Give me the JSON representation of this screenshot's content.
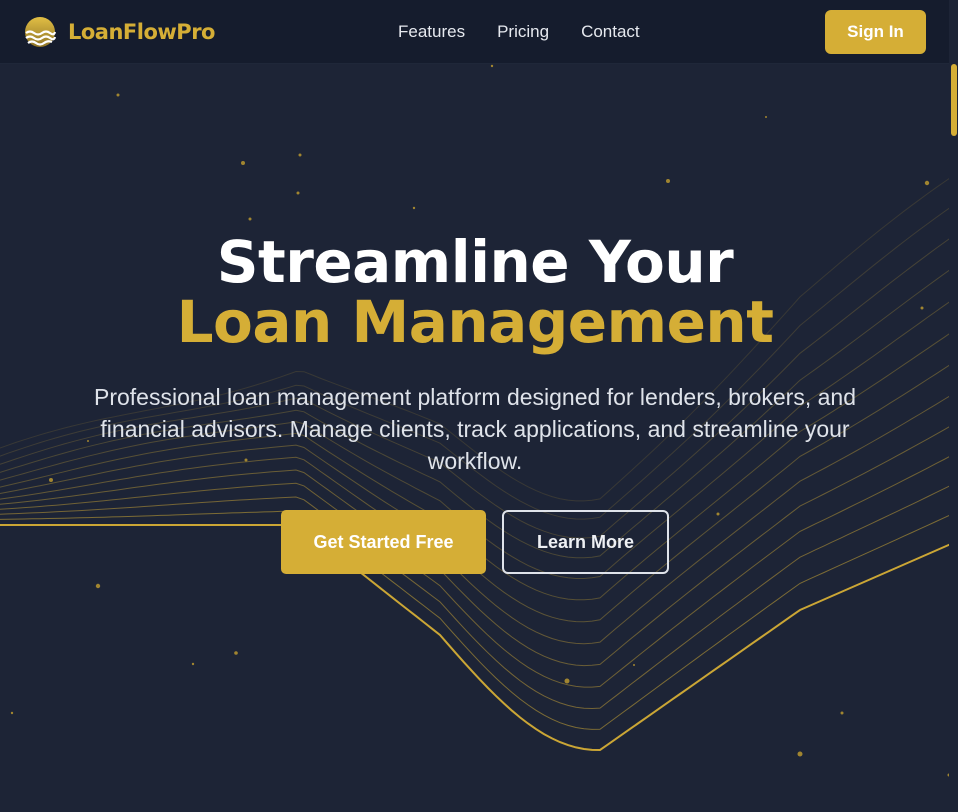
{
  "navbar": {
    "brand_name": "LoanFlowPro",
    "logo_icon": "sun-over-waves-icon",
    "links": [
      "Features",
      "Pricing",
      "Contact"
    ],
    "signin_label": "Sign In"
  },
  "hero": {
    "title_line1": "Streamline Your",
    "title_line2": "Loan Management",
    "subtitle": "Professional loan management platform designed for lenders, brokers, and financial advisors. Manage clients, track applications, and streamline your workflow.",
    "primary_cta": "Get Started Free",
    "secondary_cta": "Learn More"
  },
  "colors": {
    "background": "#1d2436",
    "navbar": "#151c2d",
    "accent": "#d5ae36",
    "text": "#ffffff"
  }
}
